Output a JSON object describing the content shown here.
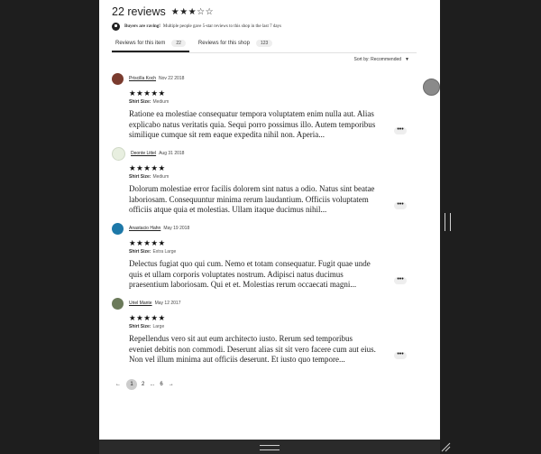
{
  "header": {
    "title": "22 reviews",
    "rating_stars": "★★★☆☆"
  },
  "notice": {
    "bold": "Buyers are raving!",
    "text": "Multiple people gave 5-star reviews to this shop in the last 7 days"
  },
  "tabs": [
    {
      "label": "Reviews for this item",
      "count": "22"
    },
    {
      "label": "Reviews for this shop",
      "count": "123"
    }
  ],
  "sort": {
    "label": "Sort by: Recommended",
    "caret": "▼"
  },
  "reviews": [
    {
      "name": "Priscilla Koch",
      "date": "Nov 22 2018",
      "stars": "★★★★★",
      "size_label": "Shirt Size:",
      "size": "Medium",
      "text": "Ratione ea molestiae consequatur tempora voluptatem enim nulla aut. Alias explicabo natus veritatis quia. Sequi porro possimus illo. Autem temporibus similique cumque sit rem eaque expedita nihil non. Aperia...",
      "avatar_color": "#7a3b2e"
    },
    {
      "name": "Deonte Littel",
      "date": "Aug 31 2018",
      "stars": "★★★★★",
      "size_label": "Shirt Size:",
      "size": "Medium",
      "text": "Dolorum molestiae error facilis dolorem sint natus a odio. Natus sint beatae laboriosam. Consequuntur minima rerum laudantium. Officiis voluptatem officiis atque quia et molestias. Ullam itaque ducimus nihil...",
      "avatar_color": "#e8efe0"
    },
    {
      "name": "Anastacio Hahn",
      "date": "May 19 2018",
      "stars": "★★★★★",
      "size_label": "Shirt Size:",
      "size": "Extra Large",
      "text": "Delectus fugiat quo qui cum. Nemo et totam consequatur. Fugit quae unde quis et ullam corporis voluptates nostrum. Adipisci natus ducimus praesentium laboriosam. Qui et et. Molestias rerum occaecati magni...",
      "avatar_color": "#1d78a8"
    },
    {
      "name": "Uriel Mante",
      "date": "May 12 2017",
      "stars": "★★★★★",
      "size_label": "Shirt Size:",
      "size": "Large",
      "text": "Repellendus vero sit aut eum architecto iusto. Rerum sed temporibus eveniet debitis non commodi. Deserunt alias sit sit vero facere cum aut eius. Non vel illum minima aut officiis deserunt. Et iusto quo tempore...",
      "avatar_color": "#6b7a5a"
    }
  ],
  "more_label": "•••",
  "pager": {
    "prev": "←",
    "current": "1",
    "p2": "2",
    "ellipsis": "...",
    "last": "6",
    "next": "→"
  }
}
